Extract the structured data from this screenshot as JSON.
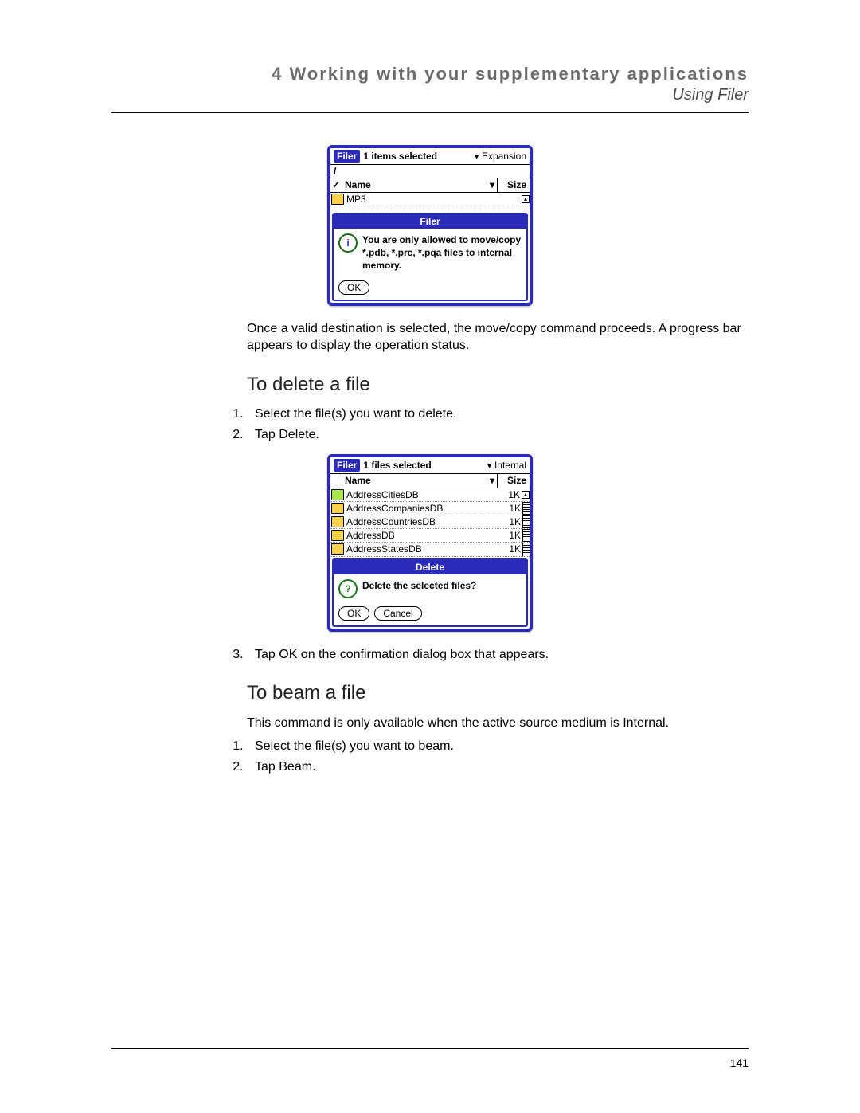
{
  "header": {
    "chapter": "4 Working with your supplementary applications",
    "section": "Using Filer"
  },
  "screenshot1": {
    "badge": "Filer",
    "status": "1 items selected",
    "location": "Expansion",
    "path": "/",
    "col_name": "Name",
    "col_size": "Size",
    "rows": [
      {
        "label": "MP3",
        "size": ""
      }
    ],
    "dialog": {
      "title": "Filer",
      "icon_letter": "i",
      "message": "You are only allowed to move/copy *.pdb, *.prc, *.pqa files to internal memory.",
      "ok": "OK"
    }
  },
  "p1": "Once a valid destination is selected, the move/copy command proceeds. A progress bar appears to display the operation status.",
  "h_delete": "To delete a file",
  "steps_delete": [
    "Select the file(s) you want to delete.",
    "Tap Delete."
  ],
  "screenshot2": {
    "badge": "Filer",
    "status": "1 files selected",
    "location": "Internal",
    "col_name": "Name",
    "col_size": "Size",
    "rows": [
      {
        "label": "AddressCitiesDB",
        "size": "1K",
        "selected": true
      },
      {
        "label": "AddressCompaniesDB",
        "size": "1K"
      },
      {
        "label": "AddressCountriesDB",
        "size": "1K"
      },
      {
        "label": "AddressDB",
        "size": "1K"
      },
      {
        "label": "AddressStatesDB",
        "size": "1K"
      }
    ],
    "dialog": {
      "title": "Delete",
      "icon_letter": "?",
      "message": "Delete the selected files?",
      "ok": "OK",
      "cancel": "Cancel"
    }
  },
  "step_delete_3": "Tap OK on the confirmation dialog box that appears.",
  "h_beam": "To beam a file",
  "p_beam": "This command is only available when the active source medium is Internal.",
  "steps_beam": [
    "Select the file(s) you want to beam.",
    "Tap Beam."
  ],
  "page_number": "141"
}
